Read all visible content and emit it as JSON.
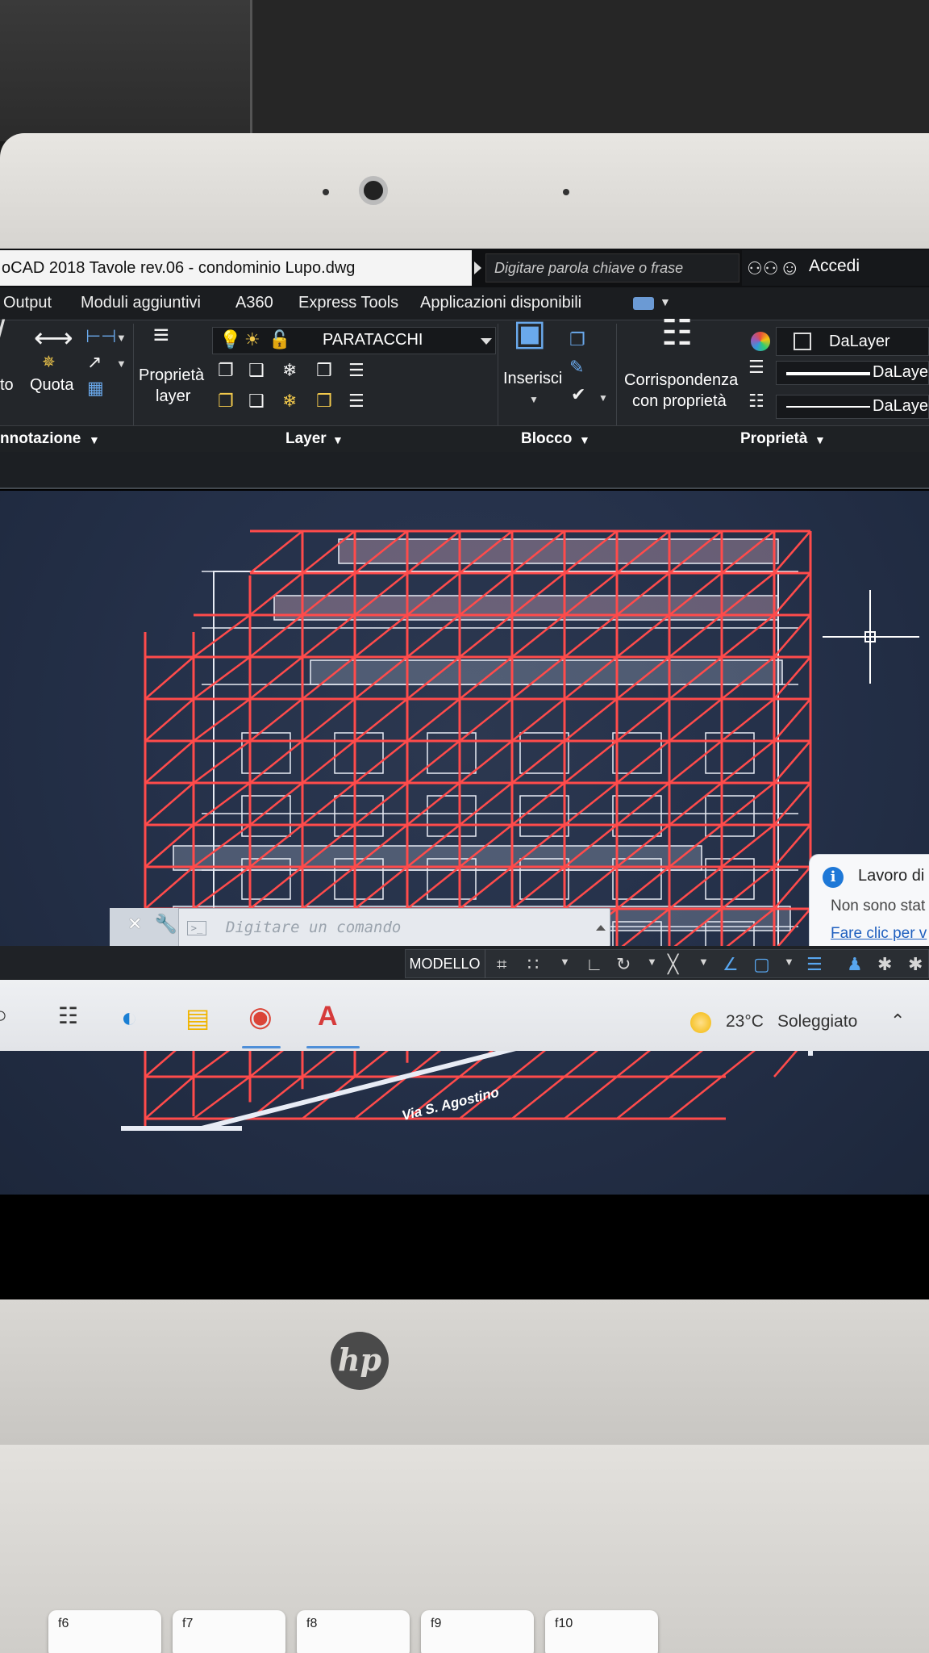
{
  "window": {
    "title": "oCAD 2018    Tavole rev.06 - condominio Lupo.dwg",
    "search_placeholder": "Digitare parola chiave o frase",
    "login_label": "Accedi"
  },
  "menu": {
    "items": [
      "Output",
      "Moduli aggiuntivi",
      "A360",
      "Express Tools",
      "Applicazioni disponibili"
    ]
  },
  "ribbon": {
    "annotation": {
      "label": "nnotazione",
      "partial_button": "to",
      "dimension_button": "Quota"
    },
    "layer": {
      "label": "Layer",
      "props_button_line1": "Proprietà",
      "props_button_line2": "layer",
      "current_layer": "PARATACCHI"
    },
    "block": {
      "label": "Blocco",
      "insert_button": "Inserisci"
    },
    "properties": {
      "label": "Proprietà",
      "match_button_line1": "Corrispondenza",
      "match_button_line2": "con proprietà",
      "color_value": "DaLayer",
      "lineweight_value": "DaLayer",
      "linetype_value": "DaLayer"
    }
  },
  "drawing": {
    "street_label": "Via S. Agostino",
    "scaffold_color": "#ff4b4b",
    "building_color": "#e8ecf5",
    "background_color": "#25314a"
  },
  "command_line": {
    "prompt_icon": ">_",
    "placeholder": "Digitare un comando"
  },
  "notification": {
    "title": "Lavoro di",
    "body": "Non sono stat",
    "link": "Fare clic per v"
  },
  "status_bar": {
    "model_tab": "MODELLO"
  },
  "taskbar": {
    "weather_temp": "23°C",
    "weather_desc": "Soleggiato"
  },
  "keyboard": {
    "keys": [
      "f6",
      "f7",
      "f8",
      "f9",
      "f10"
    ]
  },
  "laptop": {
    "brand": "hp"
  }
}
